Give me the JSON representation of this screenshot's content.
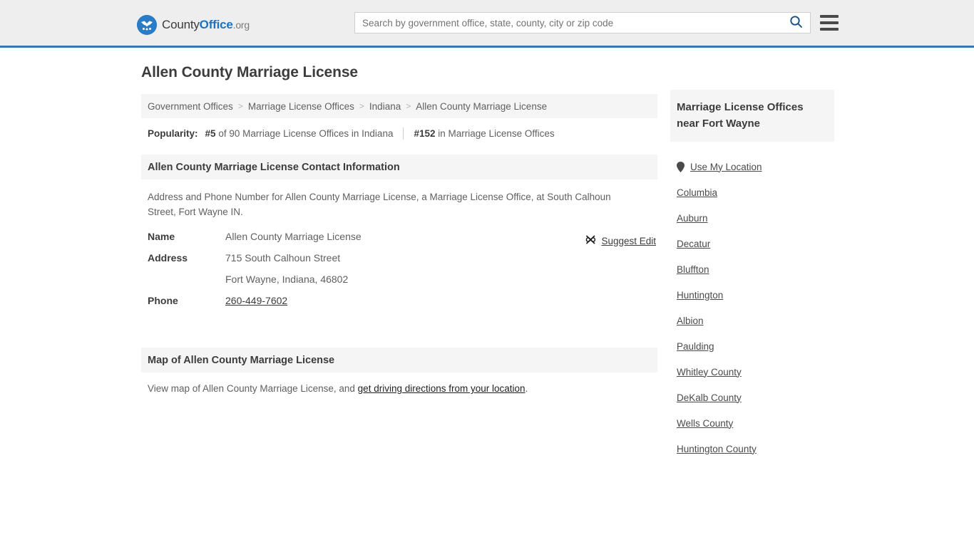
{
  "header": {
    "logo": {
      "part1": "County",
      "part2": "Office",
      "part3": ".org",
      "icon": "eagle-seal-icon"
    },
    "search": {
      "value": "",
      "placeholder": "Search by government office, state, county, city or zip code",
      "icon": "search-icon"
    },
    "menu_icon": "hamburger-menu-icon",
    "accent_color": "#3a77b0"
  },
  "main": {
    "title": "Allen County Marriage License",
    "breadcrumb": {
      "items": [
        {
          "label": "Government Offices"
        },
        {
          "label": "Marriage License Offices"
        },
        {
          "label": "Indiana"
        },
        {
          "label": "Allen County Marriage License"
        }
      ],
      "separator": ">"
    },
    "popularity": {
      "label": "Popularity:",
      "state_rank": "#5",
      "state_rank_text": "of 90 Marriage License Offices in Indiana",
      "national_rank": "#152",
      "national_rank_text": "in Marriage License Offices"
    },
    "contact": {
      "heading": "Allen County Marriage License Contact Information",
      "description": "Address and Phone Number for Allen County Marriage License, a Marriage License Office, at South Calhoun Street, Fort Wayne IN.",
      "rows": [
        {
          "key": "Name",
          "value": "Allen County Marriage License"
        },
        {
          "key": "Address",
          "value": "715 South Calhoun Street"
        },
        {
          "key": "",
          "value": "Fort Wayne, Indiana, 46802"
        }
      ],
      "phone": {
        "key": "Phone",
        "value": "260-449-7602"
      },
      "suggest_edit": {
        "label": "Suggest Edit",
        "icon": "edit-pencil-icon"
      }
    },
    "map": {
      "heading": "Map of Allen County Marriage License",
      "text_before": "View map of Allen County Marriage License, and ",
      "link": "get driving directions from your location",
      "text_after": "."
    }
  },
  "sidebar": {
    "heading": "Marriage License Offices near Fort Wayne",
    "use_my_location": {
      "label": "Use My Location",
      "icon": "map-pin-icon"
    },
    "items": [
      {
        "label": "Columbia"
      },
      {
        "label": "Auburn"
      },
      {
        "label": "Decatur"
      },
      {
        "label": "Bluffton"
      },
      {
        "label": "Huntington"
      },
      {
        "label": "Albion"
      },
      {
        "label": "Paulding"
      },
      {
        "label": "Whitley County"
      },
      {
        "label": "DeKalb County"
      },
      {
        "label": "Wells County"
      },
      {
        "label": "Huntington County"
      }
    ]
  }
}
